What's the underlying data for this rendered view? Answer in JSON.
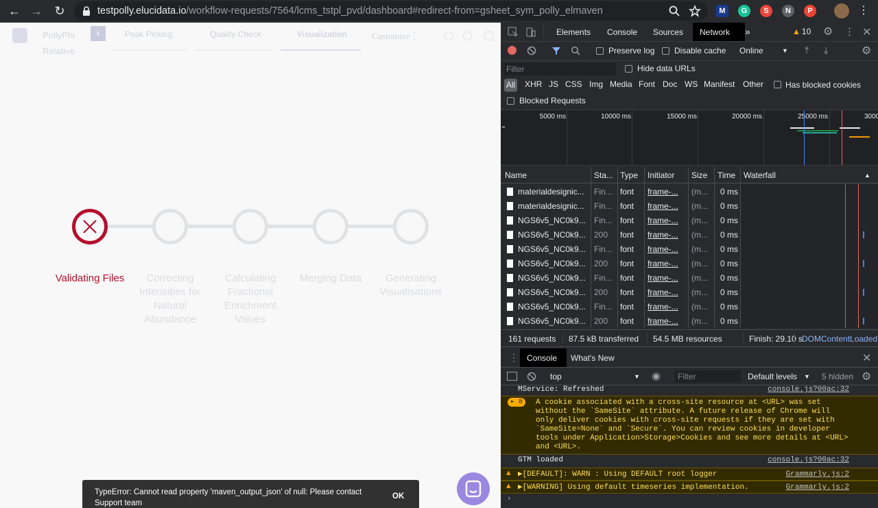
{
  "browser": {
    "url_domain": "testpolly.elucidata.io",
    "url_path": "/workflow-requests/7564/lcms_tstpl_pvd/dashboard#redirect-from=gsheet_sym_polly_elmaven",
    "extensions": [
      "M",
      "G",
      "S",
      "N",
      "P"
    ]
  },
  "app": {
    "brand_line1": "PollyPhi",
    "brand_line2": "Relative",
    "tabs": [
      "Peak Picking",
      "Quality Check",
      "Visualization"
    ],
    "customize_label": "Customize",
    "steps": [
      {
        "label": "Validating Files",
        "state": "error"
      },
      {
        "label": "Correcting Intensities for Natural Abundance",
        "state": "pending"
      },
      {
        "label": "Calculating Fractional Enrichment Values",
        "state": "pending"
      },
      {
        "label": "Merging Data",
        "state": "pending"
      },
      {
        "label": "Generating Visualisations",
        "state": "pending"
      }
    ],
    "toast": {
      "message": "TypeError: Cannot read property 'maven_output_json' of null: Please contact Support team",
      "action": "OK"
    }
  },
  "devtools": {
    "tabs": [
      "Elements",
      "Console",
      "Sources",
      "Network"
    ],
    "active_tab": "Network",
    "warning_count": "10",
    "toolbar": {
      "preserve_log": "Preserve log",
      "disable_cache": "Disable cache",
      "throttle": "Online"
    },
    "filter_placeholder": "Filter",
    "hide_data_urls": "Hide data URLs",
    "filter_types": [
      "All",
      "XHR",
      "JS",
      "CSS",
      "Img",
      "Media",
      "Font",
      "Doc",
      "WS",
      "Manifest",
      "Other"
    ],
    "has_blocked_cookies": "Has blocked cookies",
    "blocked_requests": "Blocked Requests",
    "overview_ticks": [
      "5000 ms",
      "10000 ms",
      "15000 ms",
      "20000 ms",
      "25000 ms",
      "3000"
    ],
    "columns": [
      "Name",
      "Sta...",
      "Type",
      "Initiator",
      "Size",
      "Time",
      "Waterfall"
    ],
    "rows": [
      {
        "name": "materialdesignic...",
        "status": "Fin...",
        "type": "font",
        "initiator": "frame-...",
        "size": "(m...",
        "time": "0 ms"
      },
      {
        "name": "materialdesignic...",
        "status": "Fin...",
        "type": "font",
        "initiator": "frame-...",
        "size": "(m...",
        "time": "0 ms"
      },
      {
        "name": "NGS6v5_NC0k9...",
        "status": "Fin...",
        "type": "font",
        "initiator": "frame-...",
        "size": "(m...",
        "time": "0 ms"
      },
      {
        "name": "NGS6v5_NC0k9...",
        "status": "200",
        "type": "font",
        "initiator": "frame-...",
        "size": "(m...",
        "time": "0 ms"
      },
      {
        "name": "NGS6v5_NC0k9...",
        "status": "Fin...",
        "type": "font",
        "initiator": "frame-...",
        "size": "(m...",
        "time": "0 ms"
      },
      {
        "name": "NGS6v5_NC0k9...",
        "status": "200",
        "type": "font",
        "initiator": "frame-...",
        "size": "(m...",
        "time": "0 ms"
      },
      {
        "name": "NGS6v5_NC0k9...",
        "status": "Fin...",
        "type": "font",
        "initiator": "frame-...",
        "size": "(m...",
        "time": "0 ms"
      },
      {
        "name": "NGS6v5_NC0k9...",
        "status": "200",
        "type": "font",
        "initiator": "frame-...",
        "size": "(m...",
        "time": "0 ms"
      },
      {
        "name": "NGS6v5_NC0k9...",
        "status": "Fin...",
        "type": "font",
        "initiator": "frame-...",
        "size": "(m...",
        "time": "0 ms"
      },
      {
        "name": "NGS6v5_NC0k9...",
        "status": "200",
        "type": "font",
        "initiator": "frame-...",
        "size": "(m...",
        "time": "0 ms"
      }
    ],
    "summary": {
      "requests": "161 requests",
      "transferred": "87.5 kB transferred",
      "resources": "54.5 MB resources",
      "finish": "Finish: 29.10 s",
      "dcl": "DOMContentLoaded"
    },
    "drawer": {
      "tabs": [
        "Console",
        "What's New"
      ],
      "context": "top",
      "filter_placeholder": "Filter",
      "levels": "Default levels",
      "hidden": "5 hidden"
    },
    "console": [
      {
        "text": "MService: Refreshed",
        "source": "console.js?00ac:32",
        "kind": "log"
      },
      {
        "count": "8",
        "text": "A cookie associated with a cross-site resource at <URL> was set without the `SameSite` attribute. A future release of Chrome will only deliver cookies with cross-site requests if they are set with `SameSite=None` and `Secure`. You can review cookies in developer tools under Application>Storage>Cookies and see more details at <URL> and <URL>.",
        "kind": "warn"
      },
      {
        "text": "GTM loaded",
        "source": "console.js?00ac:32",
        "kind": "log"
      },
      {
        "text": "▶[DEFAULT]: WARN : Using DEFAULT root logger",
        "source": "Grammarly.js:2",
        "kind": "warn"
      },
      {
        "text": "▶[WARNING] Using default timeseries implementation.",
        "source": "Grammarly.js:2",
        "kind": "warn"
      }
    ]
  },
  "colors": {
    "error": "#b3102d",
    "devtools_bg": "#292a2d",
    "accent": "#8ab4f8"
  }
}
